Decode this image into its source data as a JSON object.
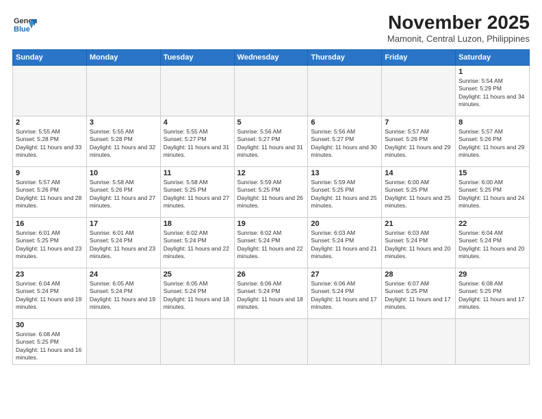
{
  "header": {
    "logo_general": "General",
    "logo_blue": "Blue",
    "month_title": "November 2025",
    "location": "Mamonit, Central Luzon, Philippines"
  },
  "weekdays": [
    "Sunday",
    "Monday",
    "Tuesday",
    "Wednesday",
    "Thursday",
    "Friday",
    "Saturday"
  ],
  "days": [
    {
      "num": "1",
      "sunrise": "5:54 AM",
      "sunset": "5:29 PM",
      "daylight": "11 hours and 34 minutes."
    },
    {
      "num": "2",
      "sunrise": "5:55 AM",
      "sunset": "5:28 PM",
      "daylight": "11 hours and 33 minutes."
    },
    {
      "num": "3",
      "sunrise": "5:55 AM",
      "sunset": "5:28 PM",
      "daylight": "11 hours and 32 minutes."
    },
    {
      "num": "4",
      "sunrise": "5:55 AM",
      "sunset": "5:27 PM",
      "daylight": "11 hours and 31 minutes."
    },
    {
      "num": "5",
      "sunrise": "5:56 AM",
      "sunset": "5:27 PM",
      "daylight": "11 hours and 31 minutes."
    },
    {
      "num": "6",
      "sunrise": "5:56 AM",
      "sunset": "5:27 PM",
      "daylight": "11 hours and 30 minutes."
    },
    {
      "num": "7",
      "sunrise": "5:57 AM",
      "sunset": "5:26 PM",
      "daylight": "11 hours and 29 minutes."
    },
    {
      "num": "8",
      "sunrise": "5:57 AM",
      "sunset": "5:26 PM",
      "daylight": "11 hours and 29 minutes."
    },
    {
      "num": "9",
      "sunrise": "5:57 AM",
      "sunset": "5:26 PM",
      "daylight": "11 hours and 28 minutes."
    },
    {
      "num": "10",
      "sunrise": "5:58 AM",
      "sunset": "5:26 PM",
      "daylight": "11 hours and 27 minutes."
    },
    {
      "num": "11",
      "sunrise": "5:58 AM",
      "sunset": "5:25 PM",
      "daylight": "11 hours and 27 minutes."
    },
    {
      "num": "12",
      "sunrise": "5:59 AM",
      "sunset": "5:25 PM",
      "daylight": "11 hours and 26 minutes."
    },
    {
      "num": "13",
      "sunrise": "5:59 AM",
      "sunset": "5:25 PM",
      "daylight": "11 hours and 25 minutes."
    },
    {
      "num": "14",
      "sunrise": "6:00 AM",
      "sunset": "5:25 PM",
      "daylight": "11 hours and 25 minutes."
    },
    {
      "num": "15",
      "sunrise": "6:00 AM",
      "sunset": "5:25 PM",
      "daylight": "11 hours and 24 minutes."
    },
    {
      "num": "16",
      "sunrise": "6:01 AM",
      "sunset": "5:25 PM",
      "daylight": "11 hours and 23 minutes."
    },
    {
      "num": "17",
      "sunrise": "6:01 AM",
      "sunset": "5:24 PM",
      "daylight": "11 hours and 23 minutes."
    },
    {
      "num": "18",
      "sunrise": "6:02 AM",
      "sunset": "5:24 PM",
      "daylight": "11 hours and 22 minutes."
    },
    {
      "num": "19",
      "sunrise": "6:02 AM",
      "sunset": "5:24 PM",
      "daylight": "11 hours and 22 minutes."
    },
    {
      "num": "20",
      "sunrise": "6:03 AM",
      "sunset": "5:24 PM",
      "daylight": "11 hours and 21 minutes."
    },
    {
      "num": "21",
      "sunrise": "6:03 AM",
      "sunset": "5:24 PM",
      "daylight": "11 hours and 20 minutes."
    },
    {
      "num": "22",
      "sunrise": "6:04 AM",
      "sunset": "5:24 PM",
      "daylight": "11 hours and 20 minutes."
    },
    {
      "num": "23",
      "sunrise": "6:04 AM",
      "sunset": "5:24 PM",
      "daylight": "11 hours and 19 minutes."
    },
    {
      "num": "24",
      "sunrise": "6:05 AM",
      "sunset": "5:24 PM",
      "daylight": "11 hours and 19 minutes."
    },
    {
      "num": "25",
      "sunrise": "6:05 AM",
      "sunset": "5:24 PM",
      "daylight": "11 hours and 18 minutes."
    },
    {
      "num": "26",
      "sunrise": "6:06 AM",
      "sunset": "5:24 PM",
      "daylight": "11 hours and 18 minutes."
    },
    {
      "num": "27",
      "sunrise": "6:06 AM",
      "sunset": "5:24 PM",
      "daylight": "11 hours and 17 minutes."
    },
    {
      "num": "28",
      "sunrise": "6:07 AM",
      "sunset": "5:25 PM",
      "daylight": "11 hours and 17 minutes."
    },
    {
      "num": "29",
      "sunrise": "6:08 AM",
      "sunset": "5:25 PM",
      "daylight": "11 hours and 17 minutes."
    },
    {
      "num": "30",
      "sunrise": "6:08 AM",
      "sunset": "5:25 PM",
      "daylight": "11 hours and 16 minutes."
    }
  ]
}
